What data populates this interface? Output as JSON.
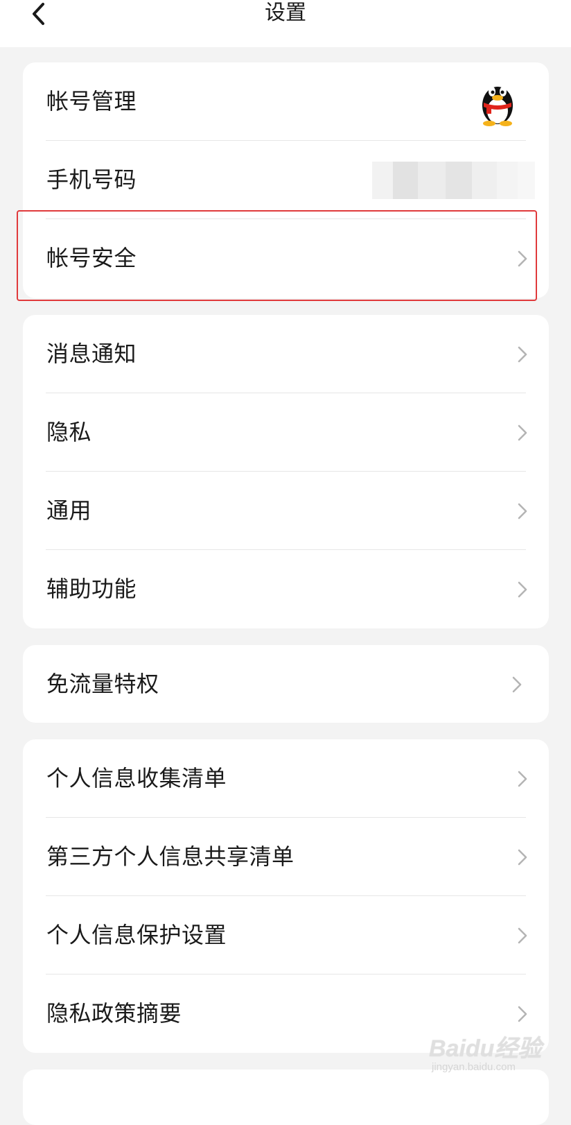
{
  "header": {
    "title": "设置"
  },
  "groups": [
    {
      "items": [
        {
          "label": "帐号管理",
          "trailing": "qq-avatar-icon"
        },
        {
          "label": "手机号码",
          "trailing": "masked-value"
        },
        {
          "label": "帐号安全",
          "trailing": "chevron-right-icon",
          "highlighted": true
        }
      ]
    },
    {
      "items": [
        {
          "label": "消息通知",
          "trailing": "chevron-right-icon"
        },
        {
          "label": "隐私",
          "trailing": "chevron-right-icon"
        },
        {
          "label": "通用",
          "trailing": "chevron-right-icon"
        },
        {
          "label": "辅助功能",
          "trailing": "chevron-right-icon"
        }
      ]
    },
    {
      "items": [
        {
          "label": "免流量特权",
          "trailing": "chevron-right-icon"
        }
      ]
    },
    {
      "items": [
        {
          "label": "个人信息收集清单",
          "trailing": "chevron-right-icon"
        },
        {
          "label": "第三方个人信息共享清单",
          "trailing": "chevron-right-icon"
        },
        {
          "label": "个人信息保护设置",
          "trailing": "chevron-right-icon"
        },
        {
          "label": "隐私政策摘要",
          "trailing": "chevron-right-icon"
        }
      ]
    }
  ],
  "watermark": {
    "brand": "Baidu经验",
    "url": "jingyan.baidu.com"
  },
  "colors": {
    "background": "#f3f3f3",
    "card": "#ffffff",
    "highlight_border": "#e0393b",
    "chevron": "#b4b4b4"
  }
}
